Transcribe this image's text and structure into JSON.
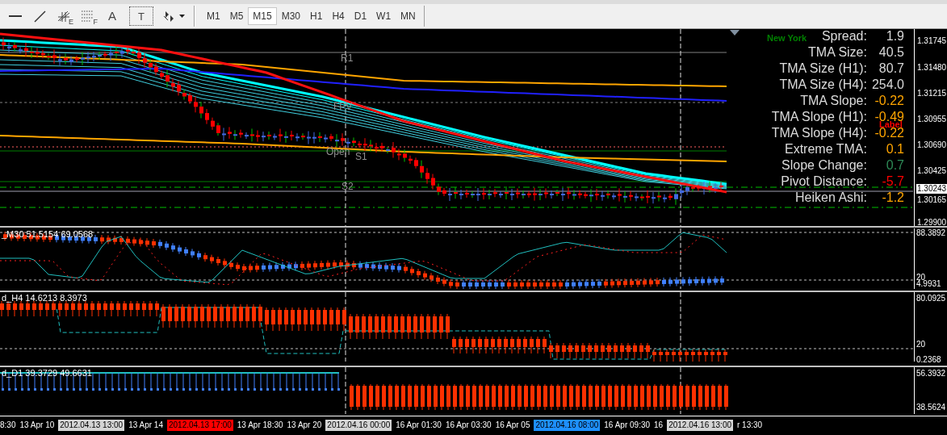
{
  "toolbar": {
    "tools": [
      {
        "kind": "hline"
      },
      {
        "kind": "trendline"
      },
      {
        "kind": "fibfan",
        "sub": "E"
      },
      {
        "kind": "fibo",
        "sub": "F"
      },
      {
        "kind": "glyph",
        "glyph": "A"
      },
      {
        "kind": "boxglyph",
        "glyph": "T"
      },
      {
        "kind": "arrows"
      }
    ],
    "timeframes": [
      {
        "label": "M1",
        "selected": false
      },
      {
        "label": "M5",
        "selected": false
      },
      {
        "label": "M15",
        "selected": true
      },
      {
        "label": "M30",
        "selected": false
      },
      {
        "label": "H1",
        "selected": false
      },
      {
        "label": "H4",
        "selected": false
      },
      {
        "label": "D1",
        "selected": false
      },
      {
        "label": "W1",
        "selected": false
      },
      {
        "label": "MN",
        "selected": false
      }
    ]
  },
  "main_chart": {
    "levels": [
      {
        "label": "R1"
      },
      {
        "label": "FPV"
      },
      {
        "label": "Open"
      },
      {
        "label": "S1"
      },
      {
        "label": "S2"
      }
    ],
    "session_label": "New York",
    "object_label": "Label",
    "info": [
      {
        "label": "Spread:",
        "value": "1.9",
        "color": "#d8d8d8"
      },
      {
        "label": "TMA Size:",
        "value": "40.5",
        "color": "#d8d8d8"
      },
      {
        "label": "TMA Size (H1):",
        "value": "80.7",
        "color": "#d8d8d8"
      },
      {
        "label": "TMA Size (H4):",
        "value": "254.0",
        "color": "#d8d8d8"
      },
      {
        "label": "TMA Slope:",
        "value": "-0.22",
        "color": "#ffa500"
      },
      {
        "label": "TMA Slope (H1):",
        "value": "-0.49",
        "color": "#ffa500"
      },
      {
        "label": "TMA Slope (H4):",
        "value": "-0.22",
        "color": "#ffa500"
      },
      {
        "label": "Extreme TMA:",
        "value": "0.1",
        "color": "#ffa500"
      },
      {
        "label": "Slope Change:",
        "value": "0.7",
        "color": "#2e8b57"
      },
      {
        "label": "Pivot Distance:",
        "value": "-5.7",
        "color": "#ff0000"
      },
      {
        "label": "Heiken Ashi:",
        "value": "-1.2",
        "color": "#ffa500"
      }
    ],
    "price_axis": [
      {
        "label": "1.31745",
        "current": false
      },
      {
        "label": "1.31480",
        "current": false
      },
      {
        "label": "1.31215",
        "current": false
      },
      {
        "label": "1.30955",
        "current": false
      },
      {
        "label": "1.30690",
        "current": false
      },
      {
        "label": "1.30425",
        "current": false
      },
      {
        "label": "1.30243",
        "current": true
      },
      {
        "label": "1.30165",
        "current": false
      },
      {
        "label": "1.29900",
        "current": false
      }
    ]
  },
  "subwindows": [
    {
      "title": "_M30 51.5154 69.0568",
      "axis": [
        "88.3892",
        "20",
        "4.9931"
      ]
    },
    {
      "title": "d_H4 14.6213 8.3973",
      "axis": [
        "80.0925",
        "20",
        "0.2368"
      ]
    },
    {
      "title": "d_D1 39.3729 49.6631",
      "axis": [
        "56.3932",
        "38.5624"
      ]
    }
  ],
  "time_axis": [
    {
      "kind": "tick",
      "label": "8:30"
    },
    {
      "kind": "tick",
      "label": "13 Apr 10"
    },
    {
      "kind": "marker",
      "label": "2012.04.13 13:00",
      "color": "#d4d4d4"
    },
    {
      "kind": "tick",
      "label": "13 Apr 14"
    },
    {
      "kind": "marker",
      "label": "2012.04.13 17:00",
      "color": "#ff0000"
    },
    {
      "kind": "tick",
      "label": "13 Apr 18:30"
    },
    {
      "kind": "tick",
      "label": "13 Apr 20"
    },
    {
      "kind": "marker",
      "label": "2012.04.16 00:00",
      "color": "#d4d4d4"
    },
    {
      "kind": "tick",
      "label": "16 Apr 01:30"
    },
    {
      "kind": "tick",
      "label": "16 Apr 03:30"
    },
    {
      "kind": "tick",
      "label": "16 Apr 05"
    },
    {
      "kind": "marker",
      "label": "2012.04.16 08:00",
      "color": "#1e90ff"
    },
    {
      "kind": "tick",
      "label": "16 Apr 09:30"
    },
    {
      "kind": "tick",
      "label": "16"
    },
    {
      "kind": "marker",
      "label": "2012.04.16 13:00",
      "color": "#d4d4d4"
    },
    {
      "kind": "tick",
      "label": "r 13:30"
    }
  ]
}
